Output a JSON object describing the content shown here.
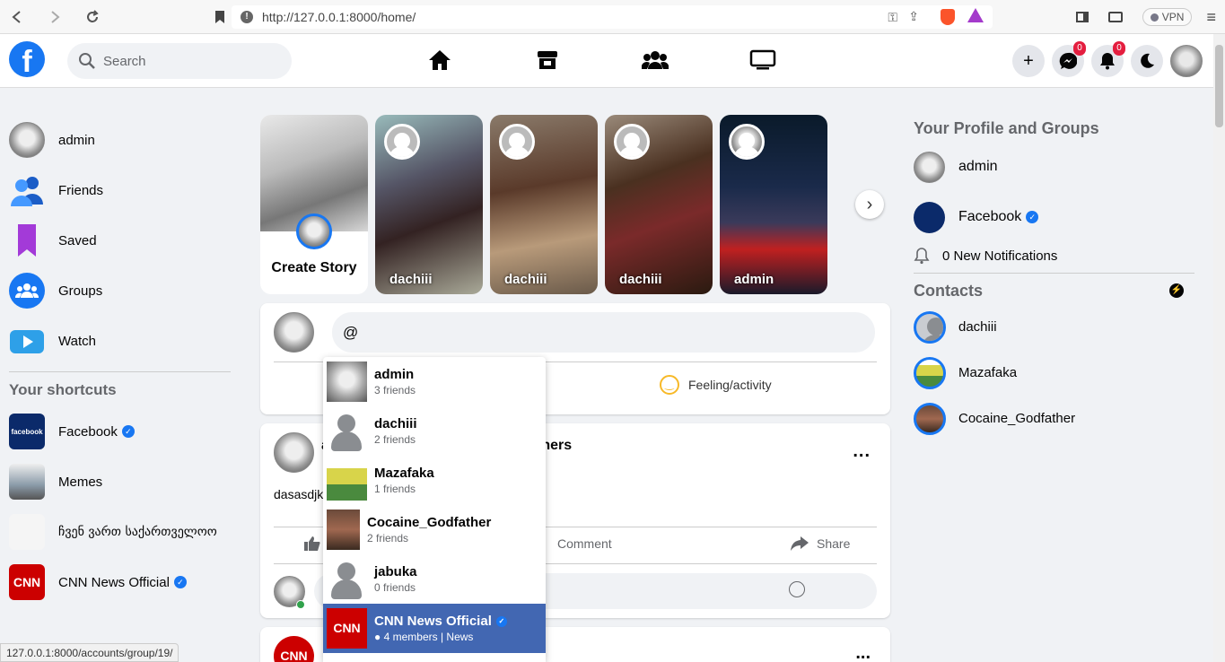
{
  "browser": {
    "url": "http://127.0.0.1:8000/home/",
    "vpn_label": "VPN",
    "status_url": "127.0.0.1:8000/accounts/group/19/"
  },
  "header": {
    "logo_letter": "f",
    "search_placeholder": "Search",
    "nav_icons": [
      "home-icon",
      "marketplace-icon",
      "groups-icon",
      "watch-icon"
    ],
    "messenger_badge": "0",
    "notifications_badge": "0"
  },
  "left_sidebar": {
    "items": [
      {
        "label": "admin",
        "icon": "avatar"
      },
      {
        "label": "Friends",
        "icon": "friends-icon"
      },
      {
        "label": "Saved",
        "icon": "saved-icon"
      },
      {
        "label": "Groups",
        "icon": "groups-icon"
      },
      {
        "label": "Watch",
        "icon": "watch-icon"
      }
    ],
    "shortcuts_title": "Your shortcuts",
    "shortcuts": [
      {
        "label": "Facebook",
        "verified": true
      },
      {
        "label": "Memes",
        "verified": false
      },
      {
        "label": "ჩვენ ვართ საქართველოო",
        "verified": false
      },
      {
        "label": "CNN News Official",
        "verified": true
      }
    ]
  },
  "stories": {
    "create_label": "Create Story",
    "items": [
      {
        "name": "dachiii"
      },
      {
        "name": "dachiii"
      },
      {
        "name": "dachiii"
      },
      {
        "name": "admin"
      }
    ]
  },
  "composer": {
    "input_value": "@",
    "feeling_label": "Feeling/activity"
  },
  "post": {
    "title_fragment": "a",
    "title_suffix": "thers",
    "text_fragment": "dasasdjk",
    "comment_label": "Comment",
    "share_label": "Share",
    "more": "..."
  },
  "post2": {
    "avatar_text": "CNN"
  },
  "mention_dropdown": {
    "items": [
      {
        "name": "admin",
        "sub": "3 friends",
        "pic": "admin"
      },
      {
        "name": "dachiii",
        "sub": "2 friends",
        "pic": "person"
      },
      {
        "name": "Mazafaka",
        "sub": "1 friends",
        "pic": "mazafaka"
      },
      {
        "name": "Cocaine_Godfather",
        "sub": "2 friends",
        "pic": "cocaine"
      },
      {
        "name": "jabuka",
        "sub": "0 friends",
        "pic": "person"
      },
      {
        "name": "CNN News Official",
        "sub": "4 members | News",
        "pic": "cnn",
        "active": true,
        "verified": true
      }
    ]
  },
  "right_sidebar": {
    "profile_title": "Your Profile and Groups",
    "profile_items": [
      {
        "label": "admin"
      },
      {
        "label": "Facebook",
        "verified": true
      }
    ],
    "notifications": "0 New Notifications",
    "contacts_title": "Contacts",
    "contacts": [
      {
        "name": "dachiii"
      },
      {
        "name": "Mazafaka"
      },
      {
        "name": "Cocaine_Godfather"
      }
    ]
  },
  "colors": {
    "brand": "#1877f2",
    "active_item": "#4267b2",
    "badge": "#e41e3f"
  }
}
